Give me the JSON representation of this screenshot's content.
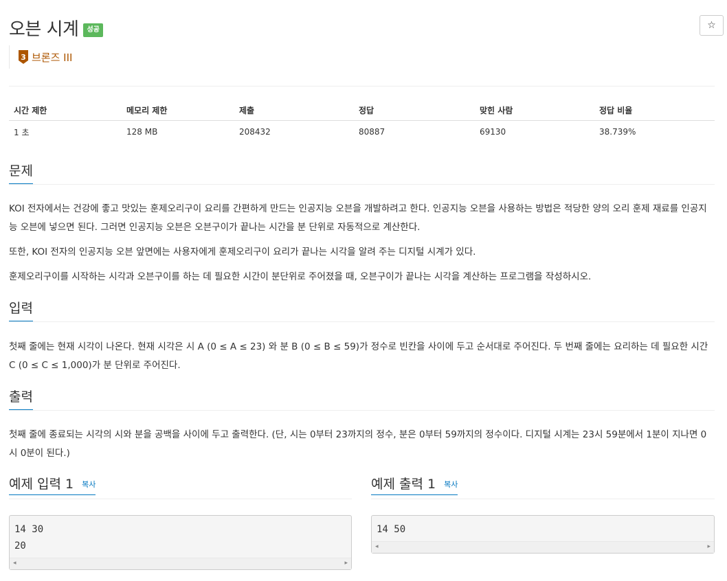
{
  "problem": {
    "title": "오븐 시계",
    "status_badge": "성공",
    "star": "☆",
    "tier": {
      "level": "3",
      "label": "브론즈 III"
    }
  },
  "info_table": {
    "headers": [
      "시간 제한",
      "메모리 제한",
      "제출",
      "정답",
      "맞힌 사람",
      "정답 비율"
    ],
    "values": [
      "1 초",
      "128 MB",
      "208432",
      "80887",
      "69130",
      "38.739%"
    ]
  },
  "sections": {
    "problem": {
      "title": "문제",
      "paragraphs": [
        "KOI 전자에서는 건강에 좋고 맛있는 훈제오리구이 요리를 간편하게 만드는 인공지능 오븐을 개발하려고 한다. 인공지능 오븐을 사용하는 방법은 적당한 양의 오리 훈제 재료를 인공지능 오븐에 넣으면 된다. 그러면 인공지능 오븐은 오븐구이가 끝나는 시간을 분 단위로 자동적으로 계산한다.",
        "또한, KOI 전자의 인공지능 오븐 앞면에는 사용자에게 훈제오리구이 요리가 끝나는 시각을 알려 주는 디지털 시계가 있다.",
        "훈제오리구이를 시작하는 시각과 오븐구이를 하는 데 필요한 시간이 분단위로 주어졌을 때, 오븐구이가 끝나는 시각을 계산하는 프로그램을 작성하시오."
      ]
    },
    "input": {
      "title": "입력",
      "text": "첫째 줄에는 현재 시각이 나온다. 현재 시각은 시 A (0 ≤ A ≤ 23) 와 분 B (0 ≤ B ≤ 59)가 정수로 빈칸을 사이에 두고 순서대로 주어진다. 두 번째 줄에는 요리하는 데 필요한 시간 C (0 ≤ C ≤ 1,000)가 분 단위로 주어진다."
    },
    "output": {
      "title": "출력",
      "text": "첫째 줄에 종료되는 시각의 시와 분을 공백을 사이에 두고 출력한다. (단, 시는 0부터 23까지의 정수, 분은 0부터 59까지의 정수이다. 디지털 시계는 23시 59분에서 1분이 지나면 0시 0분이 된다.)"
    }
  },
  "samples": {
    "input": {
      "title": "예제 입력 1",
      "copy": "복사",
      "lines": [
        "14 30",
        "20"
      ]
    },
    "output": {
      "title": "예제 출력 1",
      "copy": "복사",
      "lines": [
        "14 50"
      ]
    }
  },
  "icons": {
    "scroll_left": "◂",
    "scroll_right": "▸"
  },
  "colors": {
    "success": "#5cb85c",
    "bronze": "#ad5600",
    "link": "#0076c0"
  }
}
